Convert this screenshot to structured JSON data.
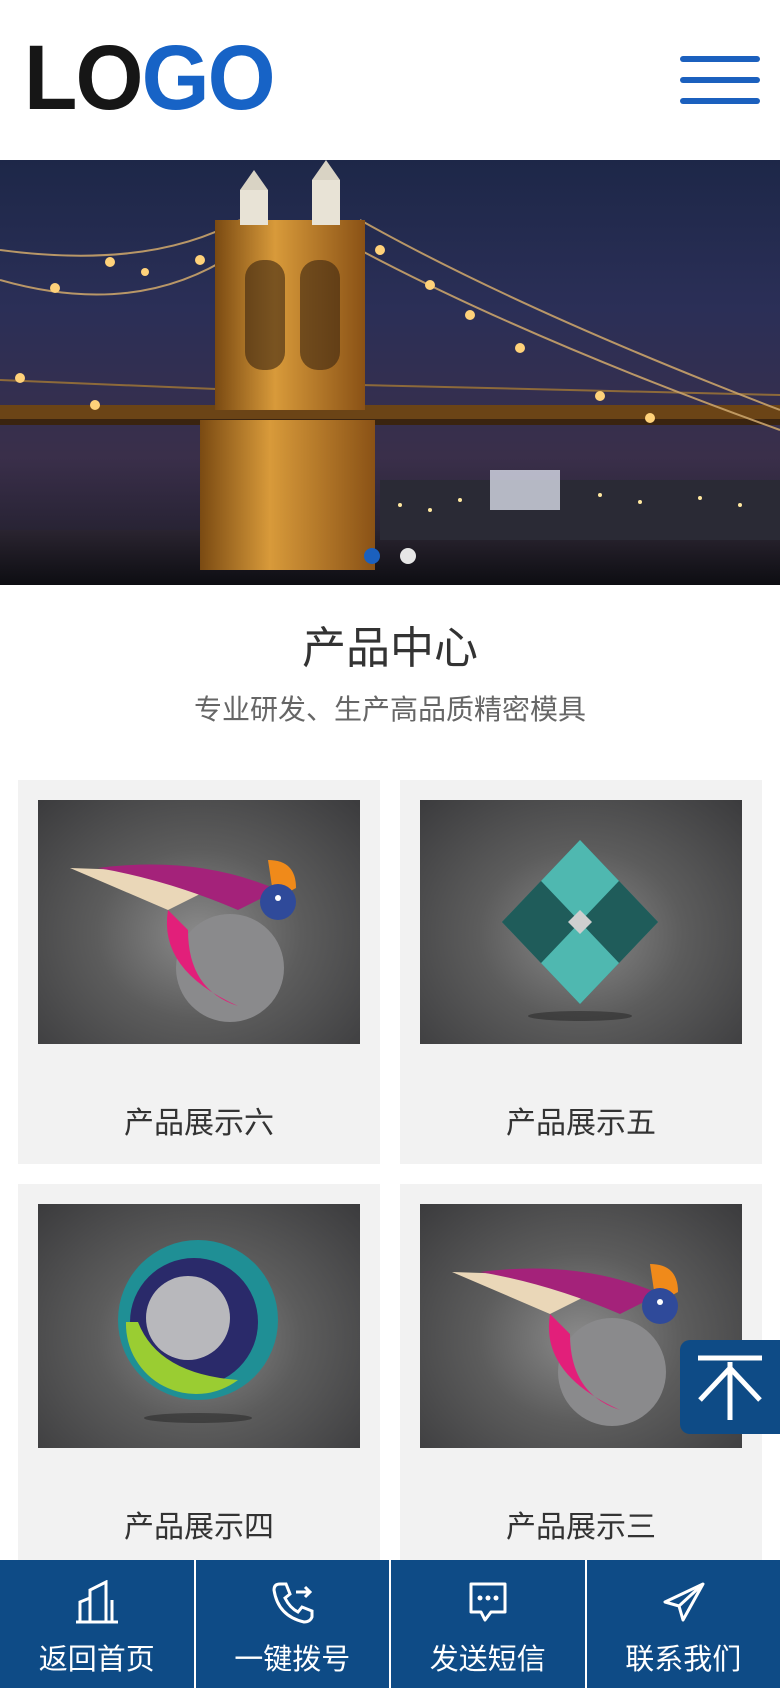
{
  "header": {
    "logo_dark": "LO",
    "logo_blue": "GO",
    "menu_icon": "hamburger-menu-icon"
  },
  "banner": {
    "slide_count": 2,
    "active_slide": 1
  },
  "products_section": {
    "title": "产品中心",
    "subtitle": "专业研发、生产高品质精密模具",
    "items": [
      {
        "label": "产品展示六",
        "image": "hummingbird-logo"
      },
      {
        "label": "产品展示五",
        "image": "teal-diamond-logo"
      },
      {
        "label": "产品展示四",
        "image": "ring-sphere-logo"
      },
      {
        "label": "产品展示三",
        "image": "hummingbird-logo"
      }
    ]
  },
  "back_to_top_icon": "arrow-up-icon",
  "footer": {
    "items": [
      {
        "label": "返回首页",
        "icon": "building-icon"
      },
      {
        "label": "一键拨号",
        "icon": "phone-icon"
      },
      {
        "label": "发送短信",
        "icon": "message-icon"
      },
      {
        "label": "联系我们",
        "icon": "paper-plane-icon"
      }
    ]
  },
  "colors": {
    "accent_blue": "#1b60be",
    "footer_bg": "#0e4b86",
    "card_bg": "#f2f2f2"
  }
}
